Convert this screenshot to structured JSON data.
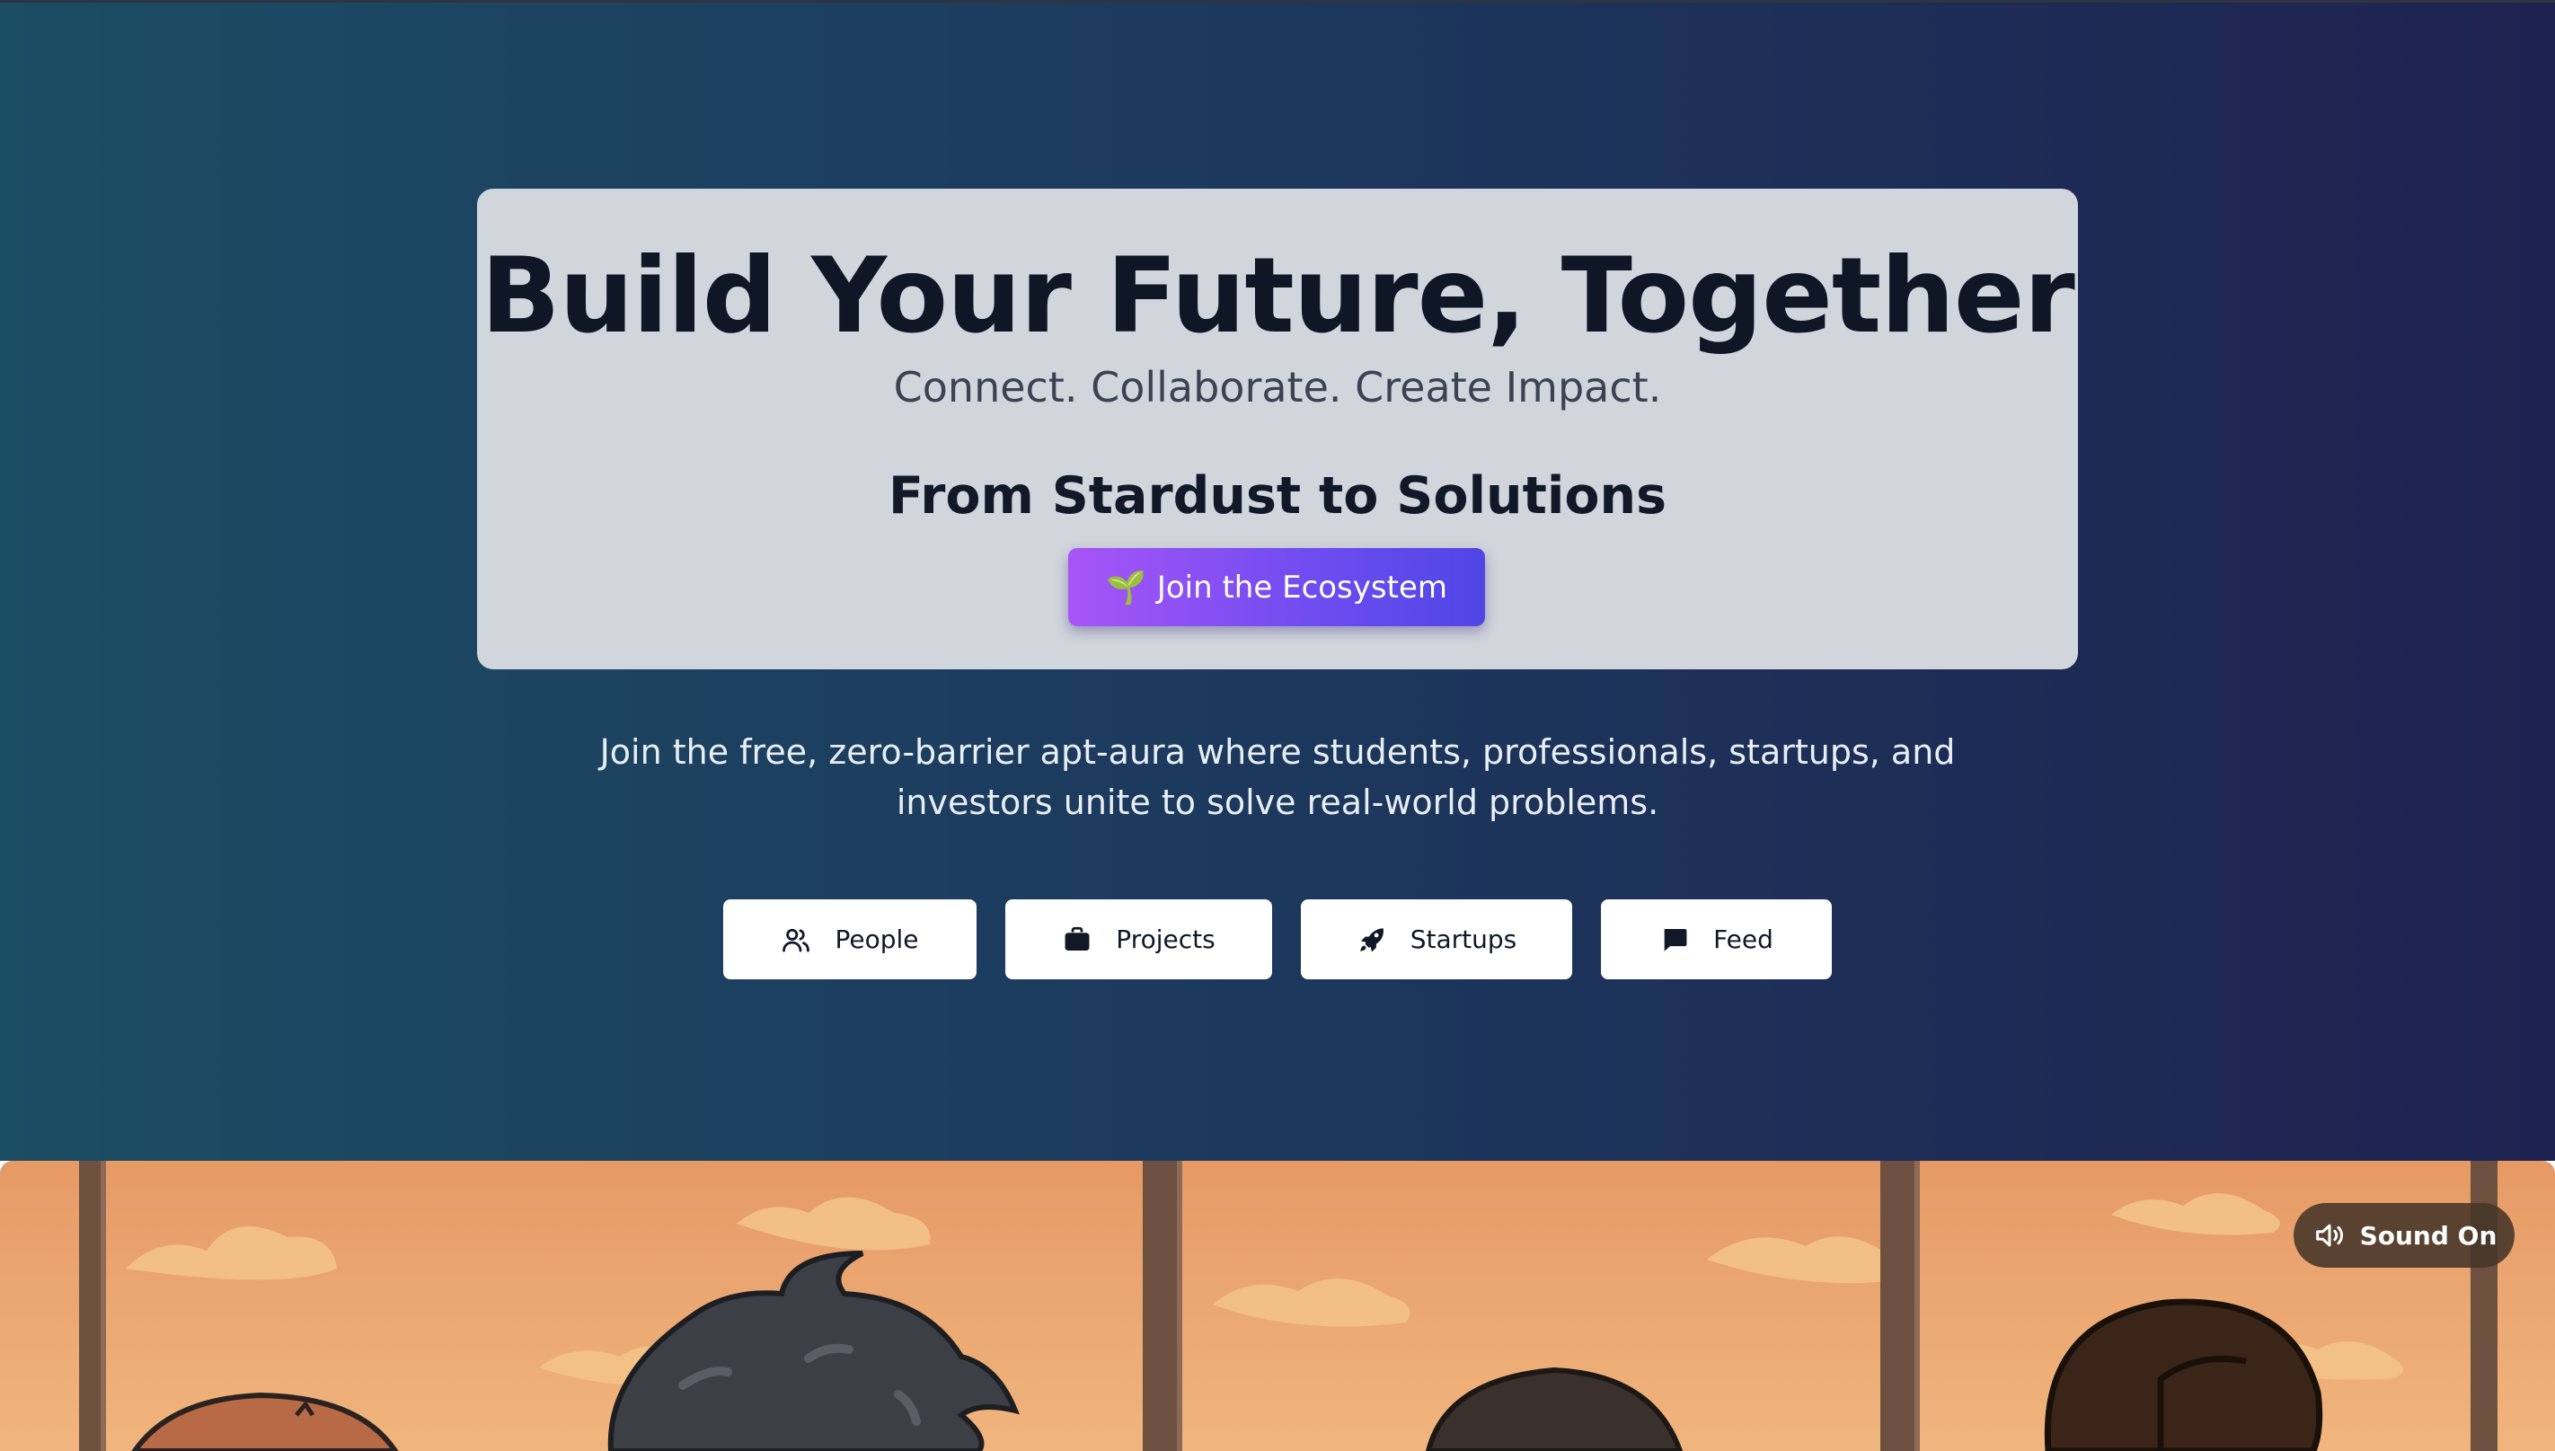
{
  "hero": {
    "headline": "Build Your Future, Together",
    "tagline": "Connect. Collaborate. Create Impact.",
    "subheading": "From Stardust to Solutions",
    "cta": {
      "icon": "sprout-icon",
      "emoji": "🌱",
      "label": "Join the Ecosystem"
    },
    "description_lines": [
      "Join the free, zero-barrier apt-aura where students, professionals, startups, and",
      "investors unite to solve real-world problems."
    ]
  },
  "nav_buttons": [
    {
      "label": "People",
      "icon": "users-icon"
    },
    {
      "label": "Projects",
      "icon": "briefcase-icon"
    },
    {
      "label": "Startups",
      "icon": "rocket-icon"
    },
    {
      "label": "Feed",
      "icon": "message-icon"
    }
  ],
  "sound_toggle": {
    "label": "Sound On",
    "icon": "speaker-icon"
  },
  "colors": {
    "gradient_start": "#1b4d63",
    "gradient_end": "#1e2250",
    "card_background": "#d1d5dc",
    "cta_start": "#a855f7",
    "cta_end": "#4f46e5",
    "banner_sky": "#e9a56e"
  }
}
